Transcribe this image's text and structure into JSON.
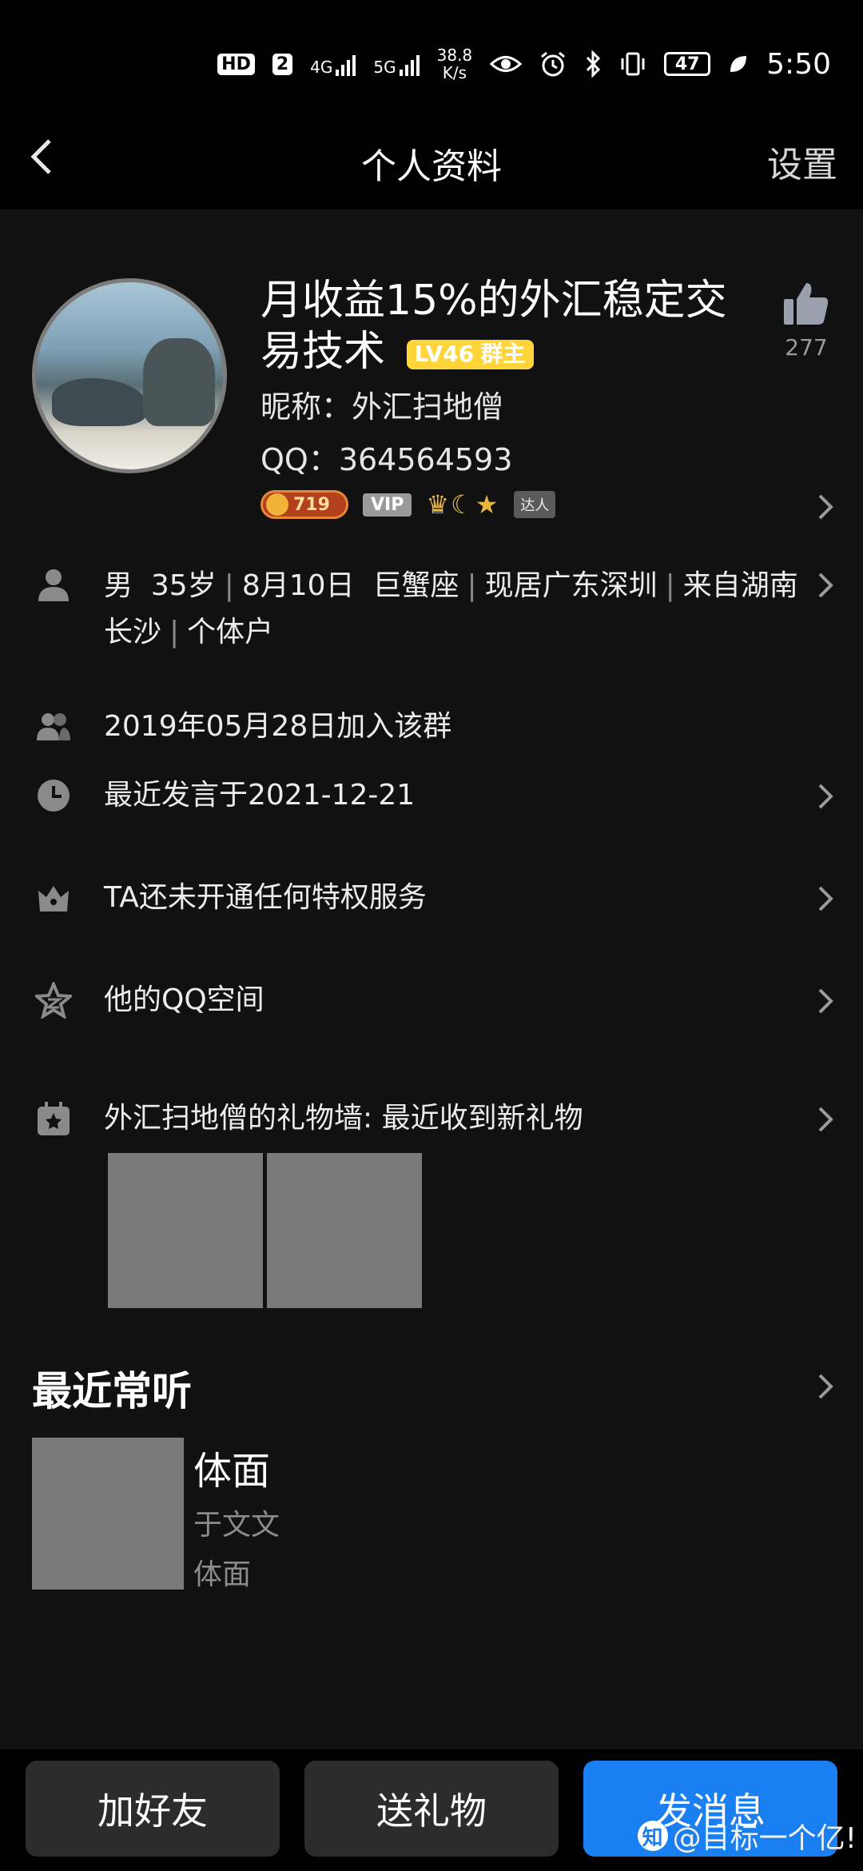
{
  "status_bar": {
    "hd_label": "HD",
    "sim_label": "2",
    "net1": "4G",
    "net2": "5G",
    "speed_value": "38.8",
    "speed_unit": "K/s",
    "battery": "47",
    "time": "5:50"
  },
  "nav": {
    "title": "个人资料",
    "settings_label": "设置"
  },
  "profile": {
    "group_name": "月收益15%的外汇稳定交易技术",
    "level_badge": "LV46",
    "role_badge": "群主",
    "nickname": "昵称：外汇扫地僧",
    "qq": "QQ：364564593",
    "like_count": "277",
    "badges": {
      "coin_value": "719",
      "vip_label": "VIP",
      "crowns": "♛☾★",
      "daren_label": "达人"
    }
  },
  "basic_info": {
    "gender": "男",
    "age": "35岁",
    "birthday": "8月10日",
    "zodiac": "巨蟹座",
    "residence": "现居广东深圳",
    "hometown": "来自湖南长沙",
    "occupation": "个体户"
  },
  "rows": {
    "join_date": "2019年05月28日加入该群",
    "last_speak": "最近发言于2021-12-21",
    "privilege": "TA还未开通任何特权服务",
    "qzone": "他的QQ空间",
    "gift_wall": "外汇扫地僧的礼物墙: 最近收到新礼物"
  },
  "recent_music": {
    "section_title": "最近常听",
    "song_title": "体面",
    "artist": "于文文",
    "album": "体面"
  },
  "bottom_bar": {
    "add_friend": "加好友",
    "send_gift": "送礼物",
    "send_message": "发消息",
    "watermark": "@目标一个亿!"
  },
  "colors": {
    "background": "#111111",
    "primary_button": "#1a7ff0",
    "level_badge": "#ffd53a"
  }
}
